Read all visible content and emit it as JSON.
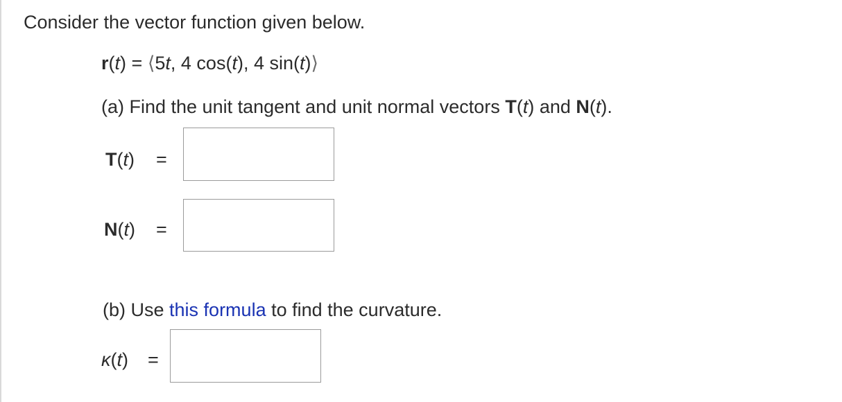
{
  "intro": "Consider the vector function given below.",
  "function_def": {
    "name": "r",
    "open_paren": "(",
    "var": "t",
    "close_eq": ") =",
    "open_angle": "⟨",
    "body_1": "5",
    "body_t1": "t",
    "body_2": ", 4 cos(",
    "body_t2": "t",
    "body_3": "), 4 sin(",
    "body_t3": "t",
    "body_4": ")",
    "close_angle": "⟩"
  },
  "part_a": {
    "prefix": "(a) Find the unit tangent and unit normal vectors ",
    "T": "T",
    "T_arg_open": "(",
    "T_arg_var": "t",
    "T_arg_close": ")",
    "and": " and ",
    "N": "N",
    "N_arg_open": "(",
    "N_arg_var": "t",
    "N_arg_close": ").",
    "T_label": {
      "sym": "T",
      "open": "(",
      "var": "t",
      "close": ")",
      "eq": "="
    },
    "N_label": {
      "sym": "N",
      "open": "(",
      "var": "t",
      "close": ")",
      "eq": "="
    },
    "T_value": "",
    "N_value": ""
  },
  "part_b": {
    "prefix": "(b) Use ",
    "link_text": "this formula",
    "suffix": " to find the curvature.",
    "kappa_label": {
      "sym": "κ",
      "open": "(",
      "var": "t",
      "close": ")",
      "eq": "="
    },
    "kappa_value": ""
  },
  "colors": {
    "text": "#2b2b2b",
    "link": "#1a33b3",
    "box_border": "#9a9a9a"
  }
}
